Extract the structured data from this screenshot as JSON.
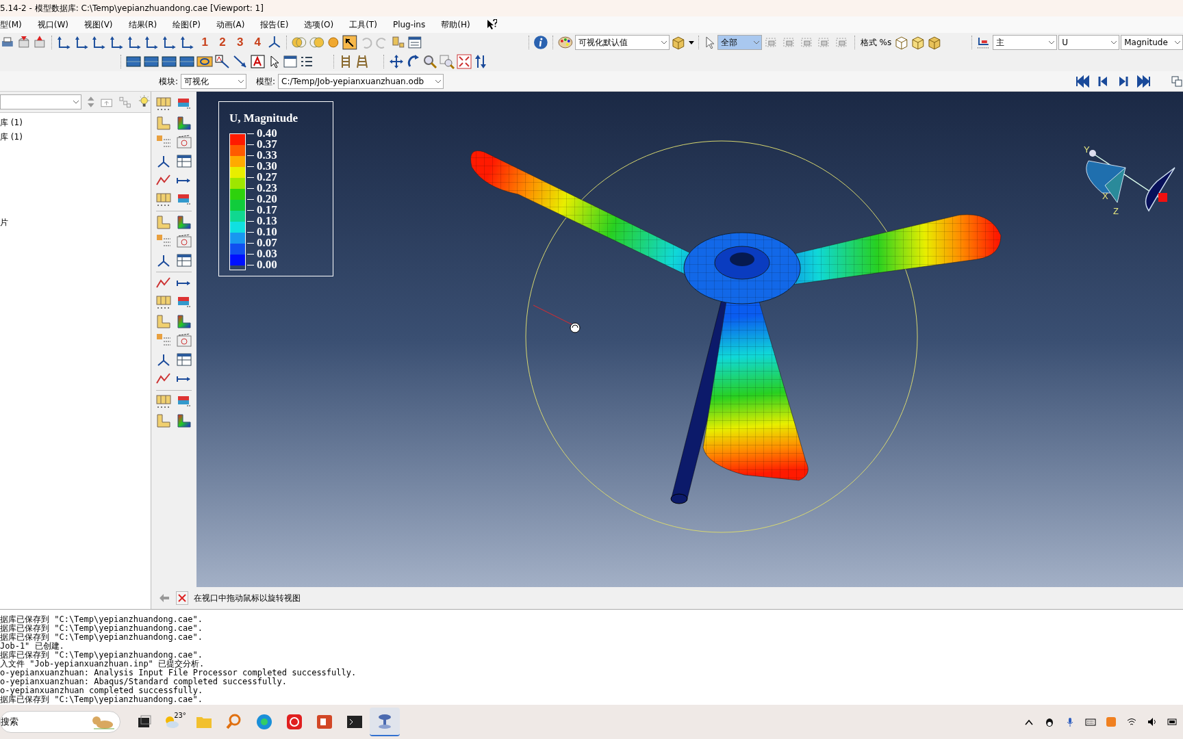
{
  "window": {
    "title": "5.14-2 - 模型数据库: C:\\Temp\\yepianzhuandong.cae [Viewport: 1]"
  },
  "menu": [
    "型(M)",
    "视口(W)",
    "视图(V)",
    "结果(R)",
    "绘图(P)",
    "动画(A)",
    "报告(E)",
    "选项(O)",
    "工具(T)",
    "Plug-ins",
    "帮助(H)"
  ],
  "toolbar": {
    "view_numbers": [
      "1",
      "2",
      "3",
      "4"
    ],
    "render_style": "可视化默认值",
    "selection": "全部",
    "format": "格式 %s",
    "step": "主",
    "variable": "U",
    "invariant": "Magnitude"
  },
  "context": {
    "module_label": "模块:",
    "module": "可视化",
    "model_label": "模型:",
    "model": "C:/Temp/Job-yepianxuanzhuan.odb"
  },
  "tree": {
    "items": [
      {
        "label": "库 (1)"
      },
      {
        "label": "库 (1)"
      },
      {
        "label": "片"
      }
    ]
  },
  "legend": {
    "title": "U, Magnitude",
    "labels": [
      "0.40",
      "0.37",
      "0.33",
      "0.30",
      "0.27",
      "0.23",
      "0.20",
      "0.17",
      "0.13",
      "0.10",
      "0.07",
      "0.03",
      "0.00"
    ],
    "bands": [
      {
        "color": "#ff1a00"
      },
      {
        "color": "#ff5a00"
      },
      {
        "color": "#ffaa00"
      },
      {
        "color": "#e8ee00"
      },
      {
        "color": "#9ee600"
      },
      {
        "color": "#2ed20c"
      },
      {
        "color": "#10cc3c"
      },
      {
        "color": "#10d890"
      },
      {
        "color": "#10e0e0"
      },
      {
        "color": "#1898f0"
      },
      {
        "color": "#1050f0"
      },
      {
        "color": "#0010ff"
      }
    ]
  },
  "triad": {
    "axes": [
      "Y",
      "X",
      "Z"
    ]
  },
  "prompt": {
    "text": "在视口中拖动鼠标以旋转视图"
  },
  "messages": [
    "据库已保存到 \"C:\\Temp\\yepianzhuandong.cae\".",
    "据库已保存到 \"C:\\Temp\\yepianzhuandong.cae\".",
    "据库已保存到 \"C:\\Temp\\yepianzhuandong.cae\".",
    "Job-1\" 已创建.",
    "据库已保存到 \"C:\\Temp\\yepianzhuandong.cae\".",
    "入文件 \"Job-yepianxuanzhuan.inp\" 已提交分析.",
    "o-yepianxuanzhuan: Analysis Input File Processor completed successfully.",
    "o-yepianxuanzhuan: Abaqus/Standard completed successfully.",
    "o-yepianxuanzhuan completed successfully.",
    "据库已保存到 \"C:\\Temp\\yepianzhuandong.cae\"."
  ],
  "taskbar": {
    "search": "搜索",
    "weather": "23°"
  }
}
